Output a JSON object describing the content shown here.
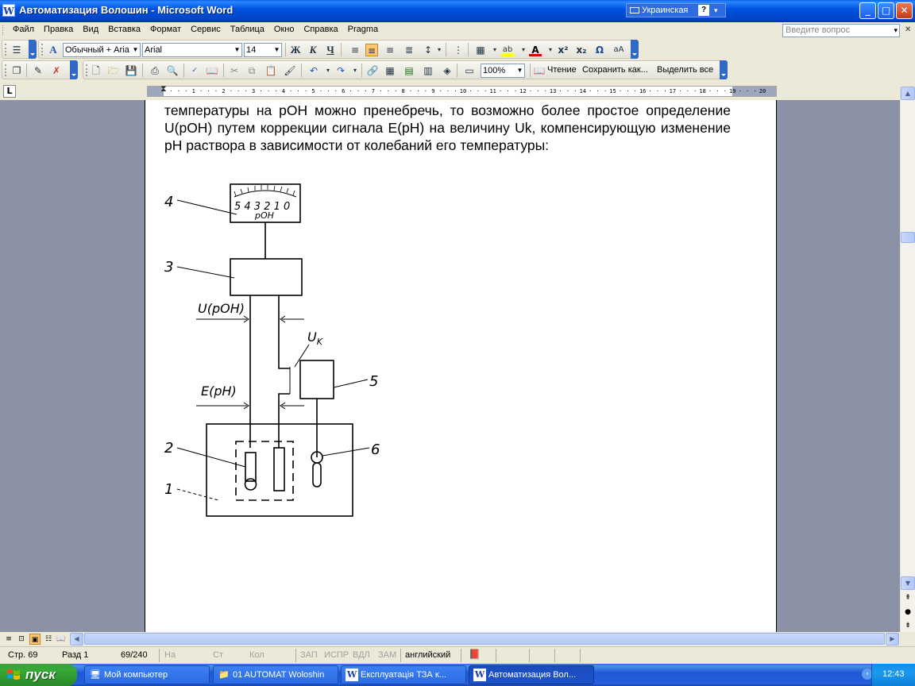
{
  "window": {
    "app_icon": "W",
    "title": "Автоматизация Волошин - Microsoft Word",
    "language": "Украинская",
    "controls": {
      "minimize": "_",
      "maximize": "□",
      "close": "✕"
    }
  },
  "menubar": {
    "items": [
      "Файл",
      "Правка",
      "Вид",
      "Вставка",
      "Формат",
      "Сервис",
      "Таблица",
      "Окно",
      "Справка",
      "Pragma"
    ],
    "help_placeholder": "Введите вопрос"
  },
  "formatting_toolbar": {
    "style": "Обычный + Aria",
    "font": "Arial",
    "size": "14",
    "bold": "Ж",
    "italic": "К",
    "underline": "Ч",
    "align_active": "center"
  },
  "standard_toolbar": {
    "zoom": "100%",
    "reading_label": "Чтение",
    "save_as_label": "Сохранить как...",
    "select_all_label": "Выделить все"
  },
  "ruler": {
    "tick_labels": [
      "1",
      "2",
      "3",
      "4",
      "5",
      "6",
      "7",
      "8",
      "9",
      "10",
      "11",
      "12",
      "13",
      "14",
      "15",
      "16",
      "17",
      "18",
      "19",
      "20"
    ]
  },
  "document": {
    "paragraph": "температуры на рОН можно пренебречь, то возможно более простое определение U(рОН) путем коррекции сигнала E(pH) на величину Uk, компенсирующую изменение рН раствора в зависимости от колебаний его температуры:",
    "figure": {
      "meter_scale": "5 4 3 2 1 0",
      "meter_unit": "рОН",
      "labels": {
        "u_poh": "U(pOH)",
        "uk": "U",
        "uk_sub": "K",
        "e_ph": "E(pH)"
      },
      "callouts": [
        "4",
        "3",
        "5",
        "2",
        "6",
        "1"
      ]
    }
  },
  "statusbar": {
    "page": "Стр. 69",
    "section": "Разд 1",
    "pages": "69/240",
    "at": "На",
    "line": "Ст",
    "col": "Кол",
    "rec": "ЗАП",
    "trk": "ИСПР",
    "ext": "ВДЛ",
    "ovr": "ЗАМ",
    "language": "английский"
  },
  "taskbar": {
    "start_label": "пуск",
    "tasks": [
      {
        "label": "Мой компьютер",
        "icon": "computer-icon"
      },
      {
        "label": "01  AUTOMAT Woloshin",
        "icon": "folder-icon"
      },
      {
        "label": "Експлуатація  ТЗА к...",
        "icon": "word-icon"
      },
      {
        "label": "Автоматизация Вол...",
        "icon": "word-icon"
      }
    ],
    "clock": "12:43"
  }
}
